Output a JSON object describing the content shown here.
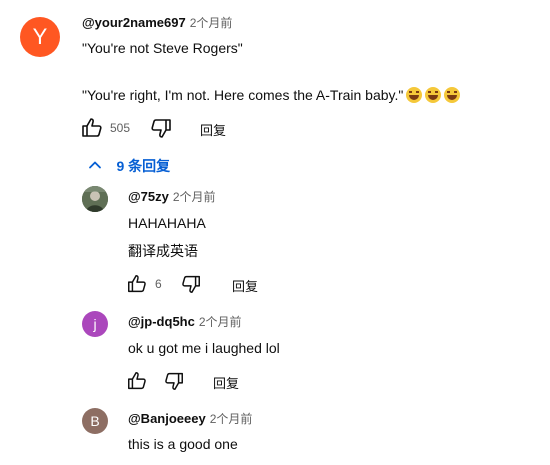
{
  "comment": {
    "avatar_letter": "Y",
    "avatar_color": "#ff5722",
    "handle": "@your2name697",
    "time": "2个月前",
    "line1": "\"You're not Steve Rogers\"",
    "line2": "\"You're right, I'm not. Here comes the A-Train baby.\"",
    "like_count": "505",
    "reply_label": "回复"
  },
  "replies_toggle": {
    "label": "9 条回复",
    "color": "#065fd4"
  },
  "replies": [
    {
      "handle": "@75zy",
      "time": "2个月前",
      "text": "HAHAHAHA",
      "translate_label": "翻译成英语",
      "like_count": "6",
      "reply_label": "回复"
    },
    {
      "avatar_letter": "j",
      "avatar_color": "#ab47bc",
      "handle": "@jp-dq5hc",
      "time": "2个月前",
      "text": "ok u got me i laughed lol",
      "reply_label": "回复"
    },
    {
      "avatar_letter": "B",
      "avatar_color": "#8d6e63",
      "handle": "@Banjoeeey",
      "time": "2个月前",
      "text": "this is a good one"
    }
  ]
}
